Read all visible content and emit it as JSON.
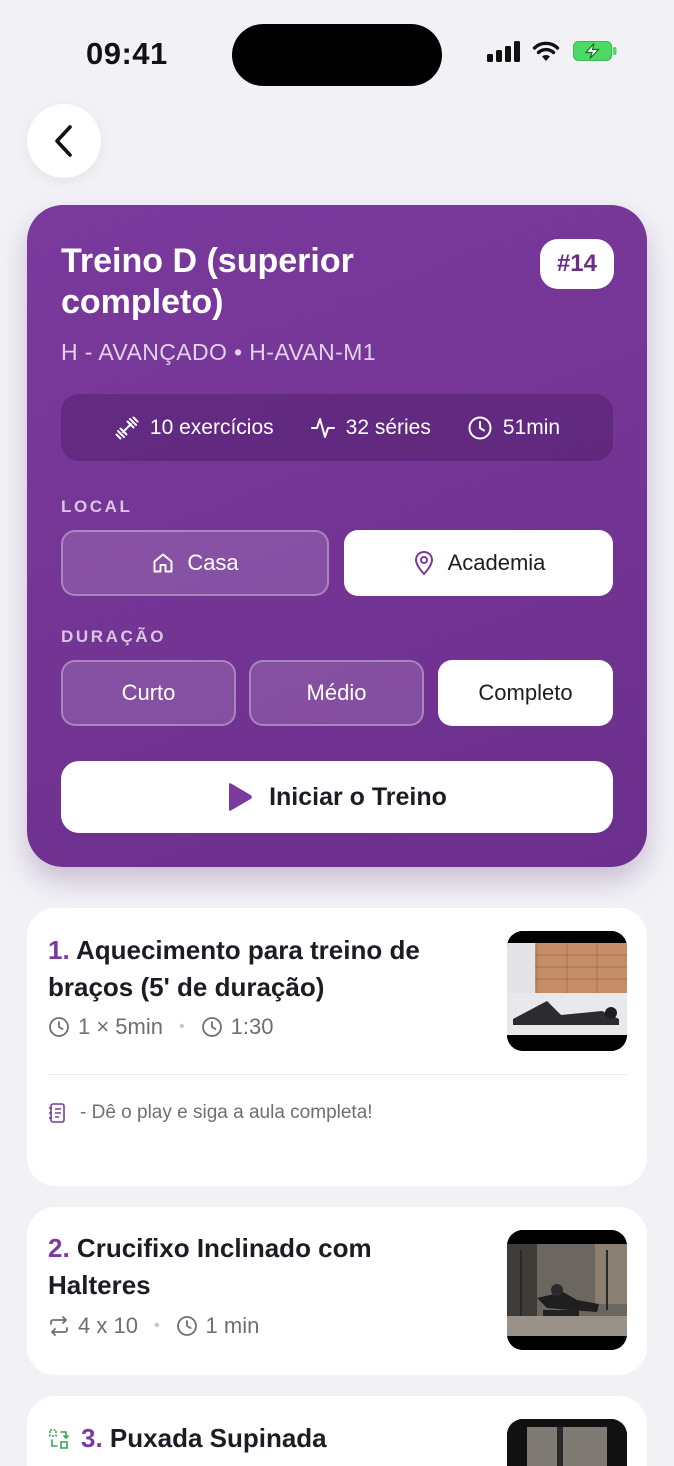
{
  "status": {
    "time": "09:41"
  },
  "header": {
    "back_icon": "chevron-left-icon"
  },
  "workout": {
    "title": "Treino D (superior completo)",
    "number": "#14",
    "subtitle": "H - AVANÇADO • H-AVAN-M1",
    "stats": {
      "exercises": "10 exercícios",
      "series": "32 séries",
      "duration": "51min"
    },
    "local": {
      "label": "LOCAL",
      "options": [
        {
          "label": "Casa",
          "selected": false
        },
        {
          "label": "Academia",
          "selected": true
        }
      ]
    },
    "duration_section": {
      "label": "DURAÇÃO",
      "options": [
        {
          "label": "Curto",
          "selected": false
        },
        {
          "label": "Médio",
          "selected": false
        },
        {
          "label": "Completo",
          "selected": true
        }
      ]
    },
    "start_label": "Iniciar o Treino",
    "accent": "#7b3a9e"
  },
  "exercises": [
    {
      "number": "1.",
      "title": "Aquecimento para treino de braços (5' de duração)",
      "sets": "1 × 5min",
      "rest": "1:30",
      "note": "- Dê o play e siga a aula completa!"
    },
    {
      "number": "2.",
      "title": "Crucifixo Inclinado com Halteres",
      "sets": "4 x 10",
      "rest": "1 min"
    },
    {
      "number": "3.",
      "title": "Puxada Supinada"
    }
  ]
}
